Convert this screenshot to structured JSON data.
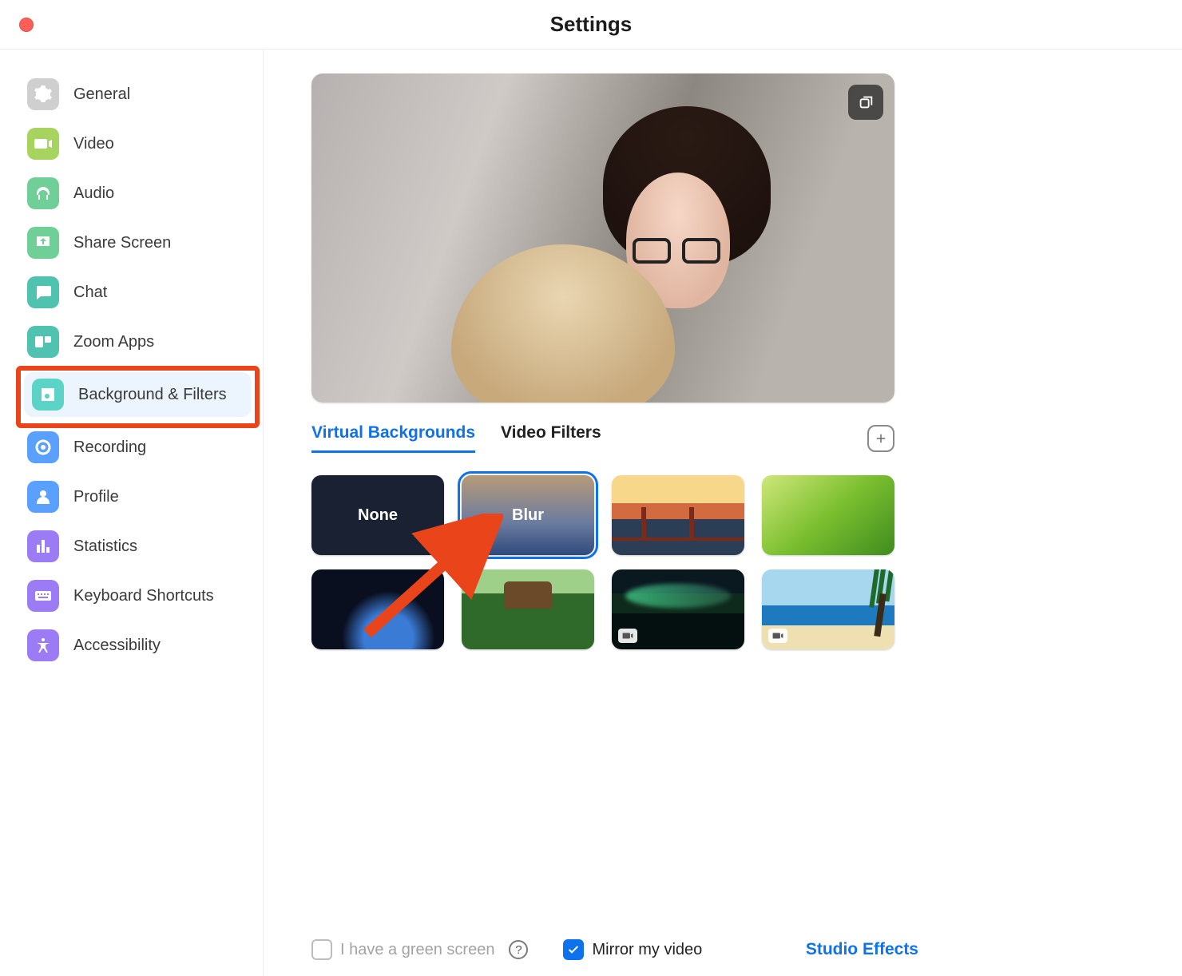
{
  "window": {
    "title": "Settings"
  },
  "sidebar": {
    "items": [
      {
        "label": "General"
      },
      {
        "label": "Video"
      },
      {
        "label": "Audio"
      },
      {
        "label": "Share Screen"
      },
      {
        "label": "Chat"
      },
      {
        "label": "Zoom Apps"
      },
      {
        "label": "Background & Filters"
      },
      {
        "label": "Recording"
      },
      {
        "label": "Profile"
      },
      {
        "label": "Statistics"
      },
      {
        "label": "Keyboard Shortcuts"
      },
      {
        "label": "Accessibility"
      }
    ],
    "colors": {
      "general": "#cfcfcf",
      "video": "#a6d45e",
      "audio": "#6fcf97",
      "share": "#6fcf97",
      "chat": "#4fc3b0",
      "apps": "#4fc3b0",
      "bg": "#5bd3c7",
      "recording": "#5aa0ff",
      "profile": "#5aa0ff",
      "stats": "#9c7cf4",
      "shortcuts": "#9c7cf4",
      "accessibility": "#9c7cf4"
    }
  },
  "tabs": {
    "virtual_backgrounds": "Virtual Backgrounds",
    "video_filters": "Video Filters"
  },
  "backgrounds": {
    "none": "None",
    "blur": "Blur"
  },
  "bottom": {
    "green_screen": "I have a green screen",
    "mirror": "Mirror my video",
    "studio": "Studio Effects"
  },
  "icons": {
    "help": "?"
  }
}
